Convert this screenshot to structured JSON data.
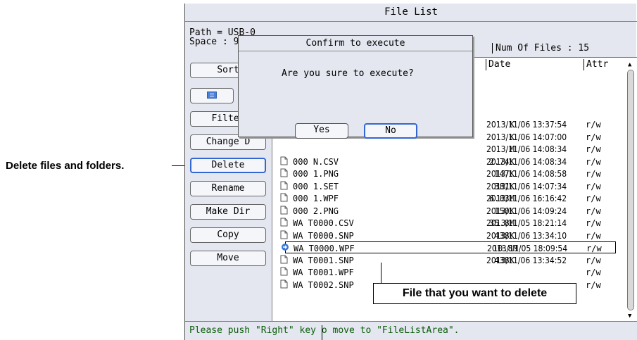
{
  "window": {
    "title": "File List"
  },
  "path": "Path = USB-0",
  "space": "Space : 9",
  "num_files": "Num Of Files : 15",
  "columns": {
    "date": "Date",
    "attr": "Attr"
  },
  "sidebar": {
    "items": [
      {
        "label": "Sort"
      },
      {
        "label": ""
      },
      {
        "label": "Filter"
      },
      {
        "label": "Change D"
      },
      {
        "label": "Delete"
      },
      {
        "label": "Rename"
      },
      {
        "label": "Make Dir"
      },
      {
        "label": "Copy"
      },
      {
        "label": "Move"
      }
    ]
  },
  "files": [
    {
      "name": "",
      "size": "K",
      "date": "2013/11/06 13:37:54",
      "attr": "r/w"
    },
    {
      "name": "",
      "size": "K",
      "date": "2013/11/06 14:07:00",
      "attr": "r/w"
    },
    {
      "name": "",
      "size": "M",
      "date": "2013/11/06 14:08:34",
      "attr": "r/w"
    },
    {
      "name": "000 N.CSV",
      "size": "2.74K",
      "date": "2013/11/06 14:08:34",
      "attr": "r/w"
    },
    {
      "name": "000 1.PNG",
      "size": "147K",
      "date": "2013/11/06 14:08:58",
      "attr": "r/w"
    },
    {
      "name": "000 1.SET",
      "size": "381K",
      "date": "2013/11/06 14:07:34",
      "attr": "r/w"
    },
    {
      "name": "000 1.WPF",
      "size": "6.03M",
      "date": "2013/11/06 16:16:42",
      "attr": "r/w"
    },
    {
      "name": "000 2.PNG",
      "size": "150K",
      "date": "2013/11/06 14:09:24",
      "attr": "r/w"
    },
    {
      "name": "WA T0000.CSV",
      "size": "35.8M",
      "date": "2013/11/05 18:21:14",
      "attr": "r/w"
    },
    {
      "name": "WA T0000.SNP",
      "size": "438K",
      "date": "2013/11/06 13:34:10",
      "attr": "r/w"
    },
    {
      "name": "WA T0000.WPF",
      "size": "10.8M",
      "date": "2013/11/05 18:09:54",
      "attr": "r/w"
    },
    {
      "name": "WA T0001.SNP",
      "size": "438K",
      "date": "2013/11/06 13:34:52",
      "attr": "r/w"
    },
    {
      "name": "WA T0001.WPF",
      "size": "",
      "date": "",
      "attr": "r/w"
    },
    {
      "name": "WA T0002.SNP",
      "size": "",
      "date": "",
      "attr": "r/w"
    }
  ],
  "statusbar": {
    "text": "Please push \"Right\" key  o move to \"FileListArea\"."
  },
  "dialog": {
    "title": "Confirm to execute",
    "message": "Are you sure to execute?",
    "yes_label": "Yes",
    "no_label": "No"
  },
  "annotations": {
    "delete_note": "Delete files and folders.",
    "file_note": "File that you want to delete"
  },
  "colors": {
    "selected_border": "#3267d2",
    "status_text": "#0a5a0a",
    "panel_bg": "#e4e7ef"
  }
}
